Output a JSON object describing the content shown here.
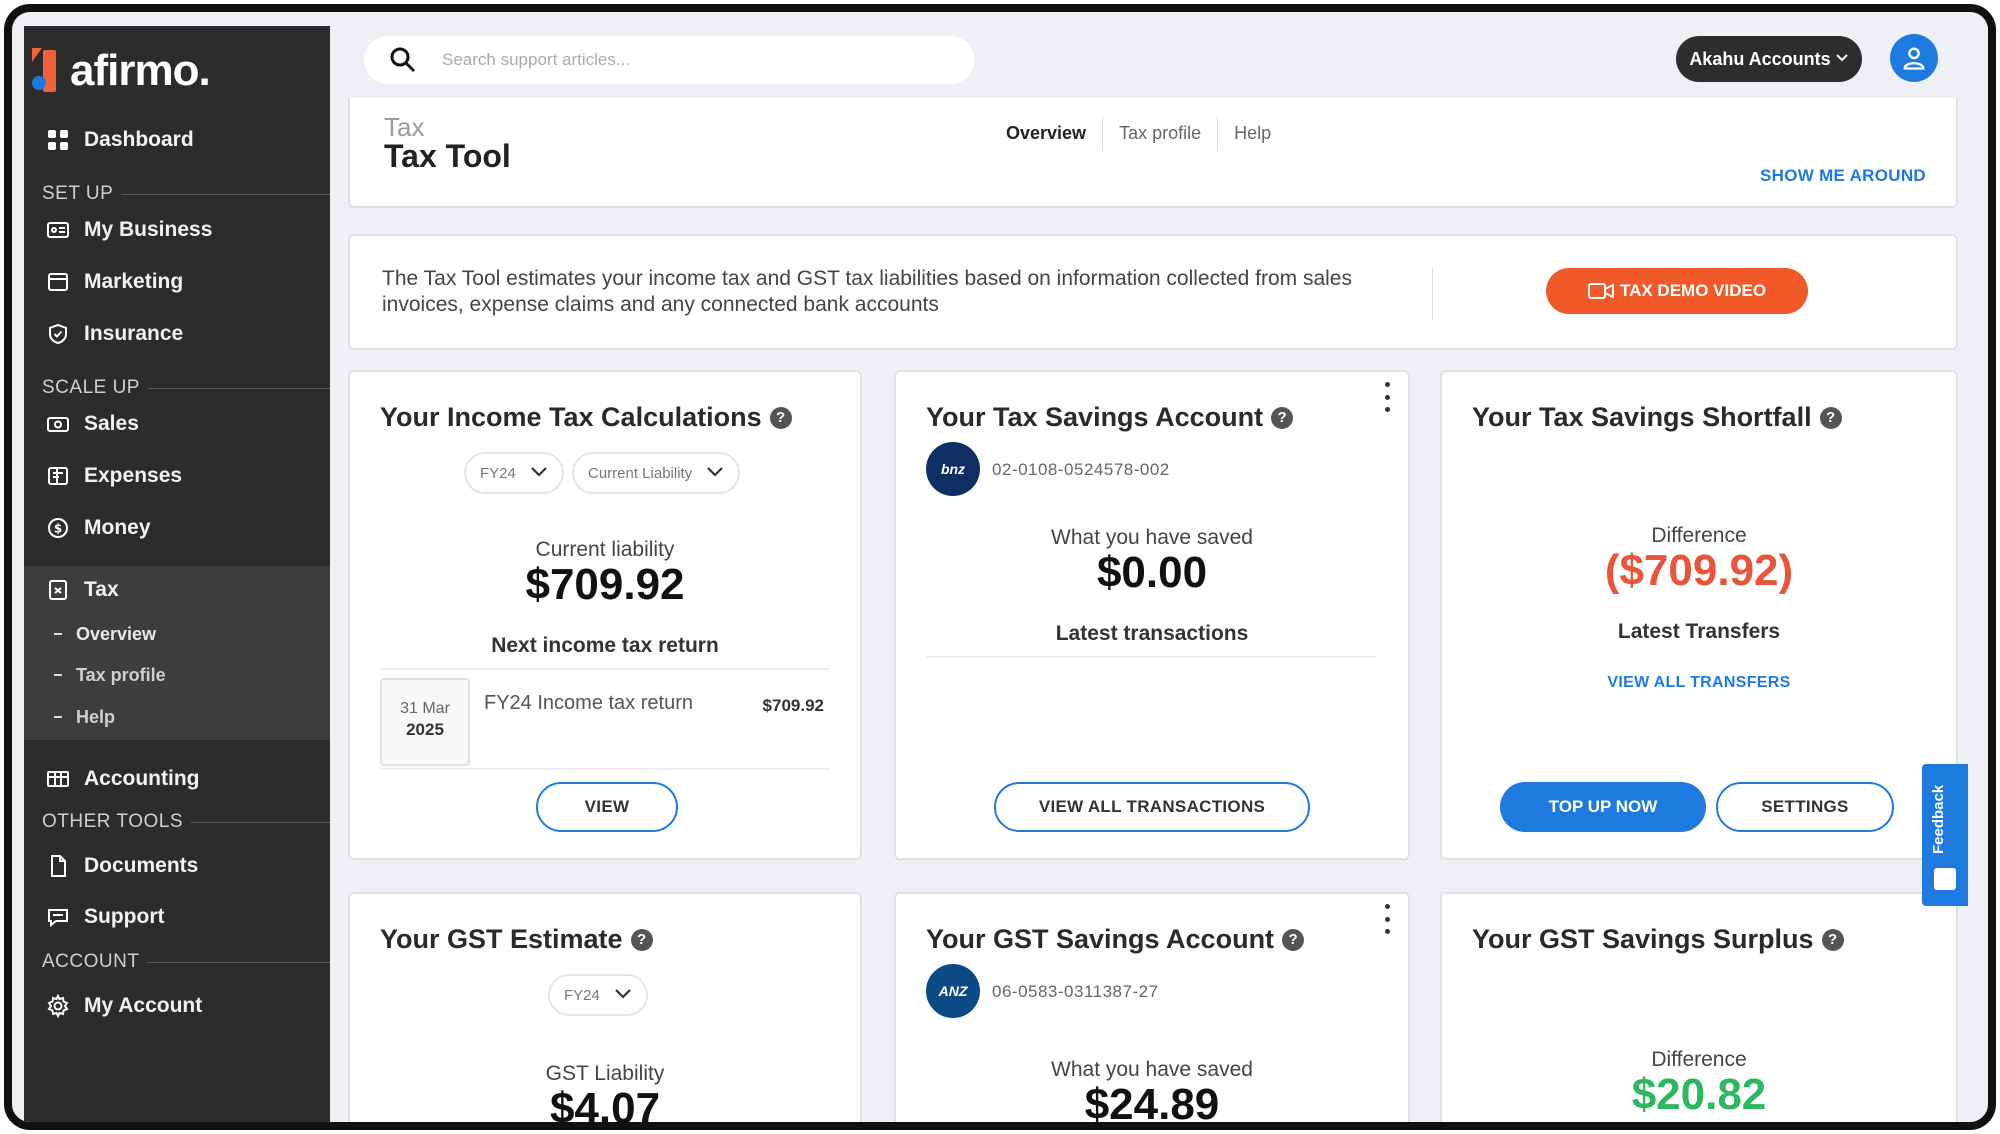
{
  "brand": {
    "name": "afirmo."
  },
  "sidebar": {
    "dashboard": "Dashboard",
    "sections": {
      "setup": "SET UP",
      "scaleup": "SCALE UP",
      "other": "OTHER TOOLS",
      "account": "ACCOUNT"
    },
    "items": {
      "my_business": "My Business",
      "marketing": "Marketing",
      "insurance": "Insurance",
      "sales": "Sales",
      "expenses": "Expenses",
      "money": "Money",
      "tax": "Tax",
      "accounting": "Accounting",
      "documents": "Documents",
      "support": "Support",
      "my_account": "My Account"
    },
    "tax_sub": {
      "overview": "Overview",
      "tax_profile": "Tax profile",
      "help": "Help"
    }
  },
  "topbar": {
    "search_placeholder": "Search support articles...",
    "account_name": "Akahu Accounts"
  },
  "header": {
    "breadcrumb": "Tax",
    "title": "Tax Tool",
    "tabs": {
      "overview": "Overview",
      "tax_profile": "Tax profile",
      "help": "Help"
    },
    "show_me_around": "SHOW ME AROUND"
  },
  "info": {
    "text": "The Tax Tool estimates your income tax and GST tax liabilities based on information collected from sales invoices, expense claims and any connected bank accounts",
    "demo_button": "TAX DEMO VIDEO"
  },
  "cards": {
    "income_tax": {
      "title": "Your Income Tax Calculations",
      "year_select": "FY24",
      "type_select": "Current Liability",
      "label": "Current liability",
      "value": "$709.92",
      "next_return_heading": "Next income tax return",
      "return_date_day": "31 Mar",
      "return_date_year": "2025",
      "return_label": "FY24 Income tax return",
      "return_amount": "$709.92",
      "view_button": "VIEW"
    },
    "tax_savings": {
      "title": "Your Tax Savings Account",
      "bank_badge": "bnz",
      "account_number": "02-0108-0524578-002",
      "label": "What you have saved",
      "value": "$0.00",
      "transactions_heading": "Latest transactions",
      "view_all_button": "VIEW ALL TRANSACTIONS"
    },
    "tax_shortfall": {
      "title": "Your Tax Savings Shortfall",
      "label": "Difference",
      "value": "($709.92)",
      "transfers_heading": "Latest Transfers",
      "view_all_link": "VIEW ALL TRANSFERS",
      "top_up_button": "TOP UP NOW",
      "settings_button": "SETTINGS"
    },
    "gst_estimate": {
      "title": "Your GST Estimate",
      "year_select": "FY24",
      "label": "GST Liability",
      "value": "$4.07"
    },
    "gst_savings": {
      "title": "Your GST Savings Account",
      "bank_badge": "ANZ",
      "account_number": "06-0583-0311387-27",
      "label": "What you have saved",
      "value": "$24.89"
    },
    "gst_surplus": {
      "title": "Your GST Savings Surplus",
      "label": "Difference",
      "value": "$20.82"
    }
  },
  "feedback": {
    "label": "Feedback"
  },
  "colors": {
    "accent": "#1f7ae0",
    "brand_orange": "#f05a2b",
    "negative": "#e8553a",
    "positive": "#2db760",
    "sidebar_bg": "#2c2c2c"
  }
}
